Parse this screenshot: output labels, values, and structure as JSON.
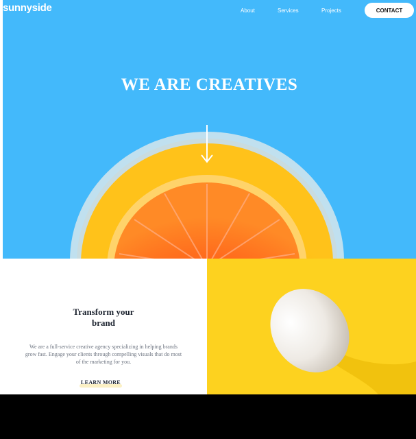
{
  "header": {
    "logo": "sunnyside",
    "nav": {
      "about": "About",
      "services": "Services",
      "projects": "Projects"
    },
    "contact_label": "CONTACT"
  },
  "hero": {
    "title": "WE ARE CREATIVES",
    "background_color": "#43b9fb",
    "arrow_icon": "arrow-down-icon"
  },
  "transform": {
    "title_line1": "Transform your",
    "title_line2": "brand",
    "body": "We are a full-service creative agency specializing in helping brands grow fast. Engage your clients through compelling visuals that do most of the marketing for you.",
    "link_label": "LEARN MORE",
    "accent_color": "#fdd21f"
  }
}
